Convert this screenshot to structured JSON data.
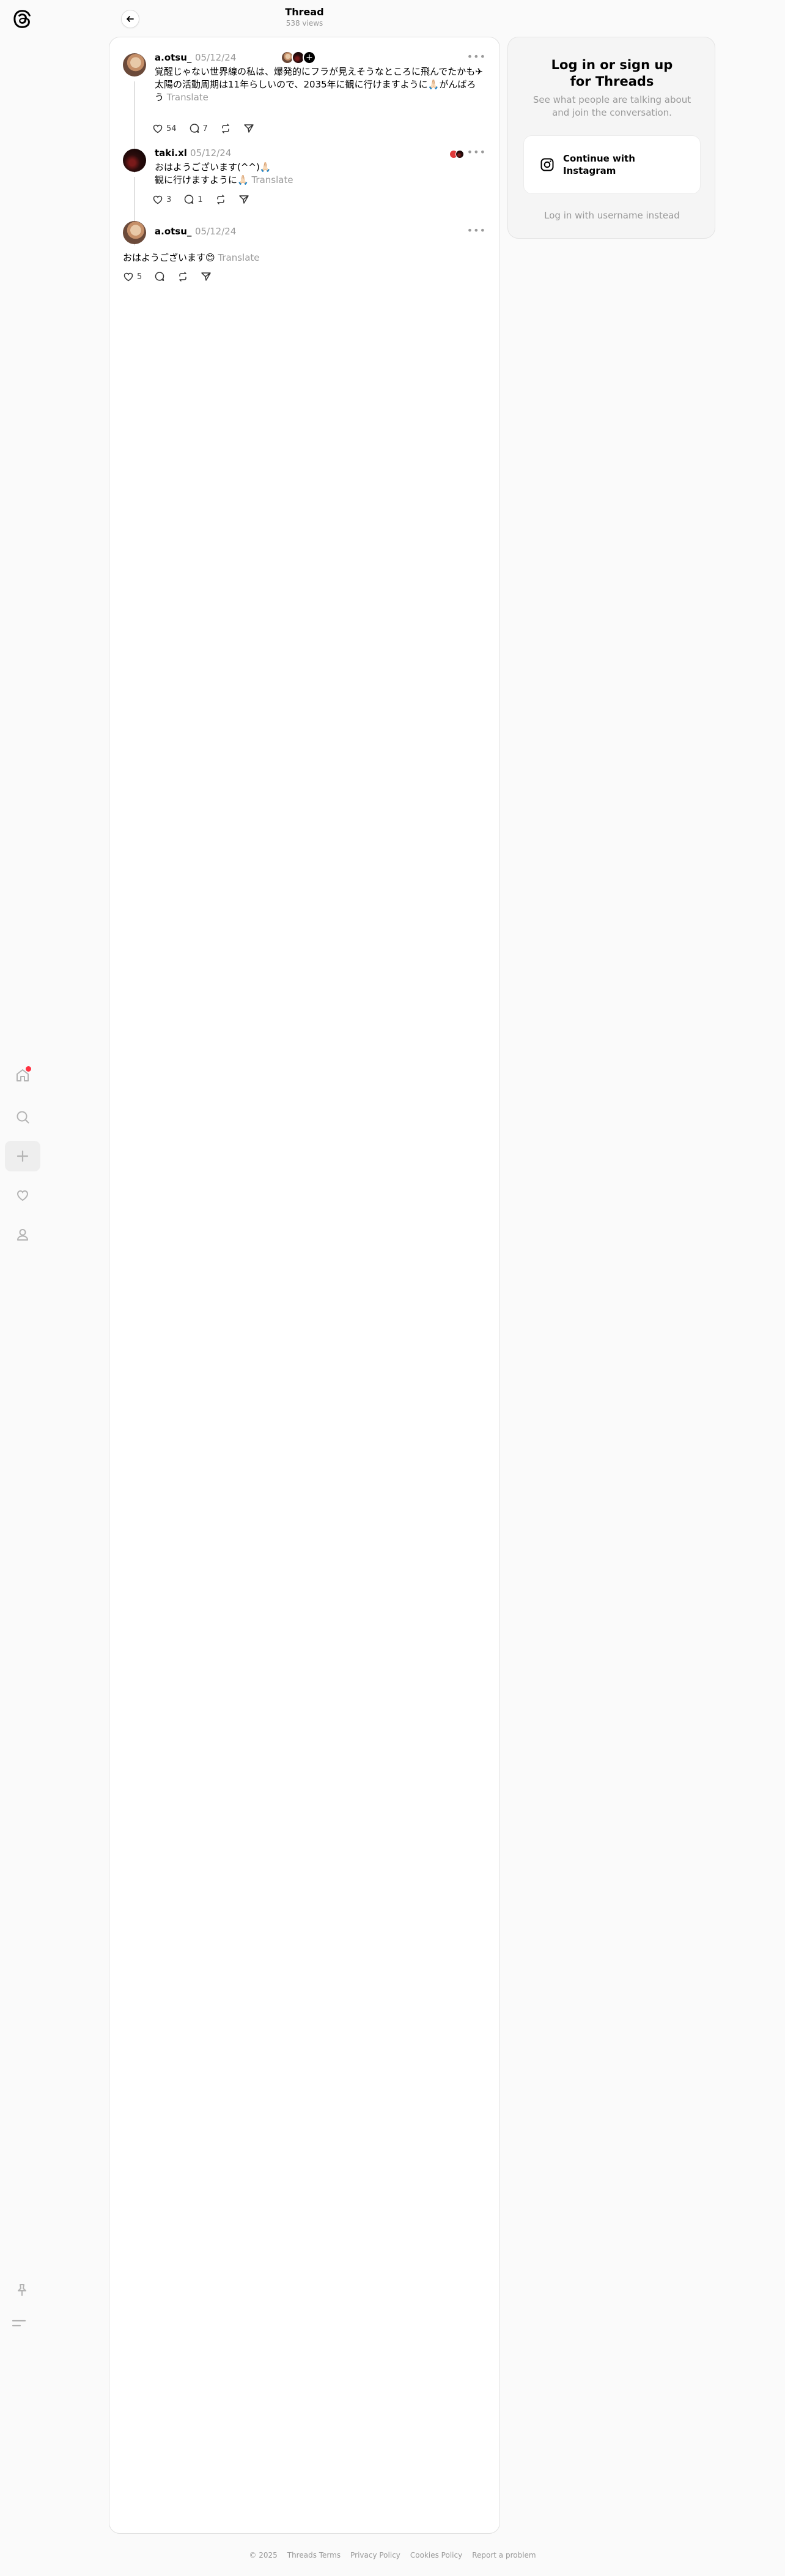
{
  "header": {
    "title": "Thread",
    "views": "538 views"
  },
  "nav": {
    "items": [
      "home-icon",
      "search-icon",
      "create-icon",
      "activity-icon",
      "profile-icon"
    ]
  },
  "posts": [
    {
      "username": "a.otsu_",
      "date": "05/12/24",
      "text": "覚醒じゃない世界線の私は、爆発的にフラが見えそうなところに飛んでたかも✈︎\n太陽の活動周期は11年らしいので、2035年に観に行けますように🙏🏻がんばろう",
      "translate": "Translate",
      "likes": "54",
      "replies": "7"
    },
    {
      "username": "taki.xl",
      "date": "05/12/24",
      "text": "おはようございます(^^)🙏🏻\n観に行けますように🙏🏻",
      "translate": "Translate",
      "likes": "3",
      "replies": "1"
    },
    {
      "username": "a.otsu_",
      "date": "05/12/24",
      "text": "おはようございます😊",
      "translate": "Translate",
      "likes": "5",
      "replies": ""
    }
  ],
  "stack_plus": "+",
  "card": {
    "title": "Log in or sign up\nfor Threads",
    "subtitle": "See what people are talking about\nand join the conversation.",
    "button": "Continue with Instagram",
    "alt": "Log in with username instead"
  },
  "footer": [
    "© 2025",
    "Threads Terms",
    "Privacy Policy",
    "Cookies Policy",
    "Report a problem"
  ],
  "colors": {
    "accent_dot": "#ff3040",
    "muted": "#999999",
    "border": "#e0e0e0"
  }
}
